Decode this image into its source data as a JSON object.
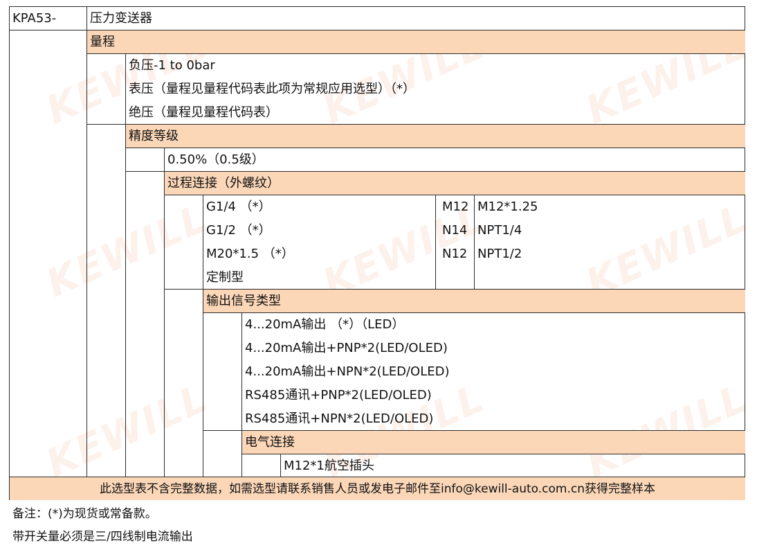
{
  "header": {
    "model": "KPA53-",
    "product": "压力变送器"
  },
  "range": {
    "title": "量程",
    "options": [
      "负压-1 to 0bar",
      "表压（量程见量程代码表此项为常规应用选型）（*）",
      "绝压（量程见量程代码表）"
    ]
  },
  "accuracy": {
    "title": "精度等级",
    "option": "0.50%（0.5级）"
  },
  "connection": {
    "title": "过程连接（外螺纹）",
    "left_options": [
      "G1/4 （*）",
      "G1/2 （*）",
      "M20*1.5 （*）",
      "定制型"
    ],
    "codes": [
      "M12",
      "N14",
      "N12"
    ],
    "code_values": [
      "M12*1.25",
      "NPT1/4",
      "NPT1/2"
    ]
  },
  "output": {
    "title": "输出信号类型",
    "options": [
      "4...20mA输出 （*）（LED）",
      "4...20mA输出+PNP*2(LED/OLED)",
      "4...20mA输出+NPN*2(LED/OLED)",
      "RS485通讯+PNP*2(LED/OLED)",
      "RS485通讯+NPN*2(LED/OLED)"
    ]
  },
  "electrical": {
    "title": "电气连接",
    "option": "M12*1航空插头"
  },
  "footer": "此选型表不含完整数据，如需选型请联系销售人员或发电子邮件至info@kewill-auto.com.cn获得完整样本",
  "notes": [
    "备注：(*)为现货或常备款。",
    "带开关量必须是三/四线制电流输出"
  ],
  "watermark": "KEWILL",
  "colors": {
    "band": "#fbd7b8",
    "border": "#2b2b2b"
  }
}
